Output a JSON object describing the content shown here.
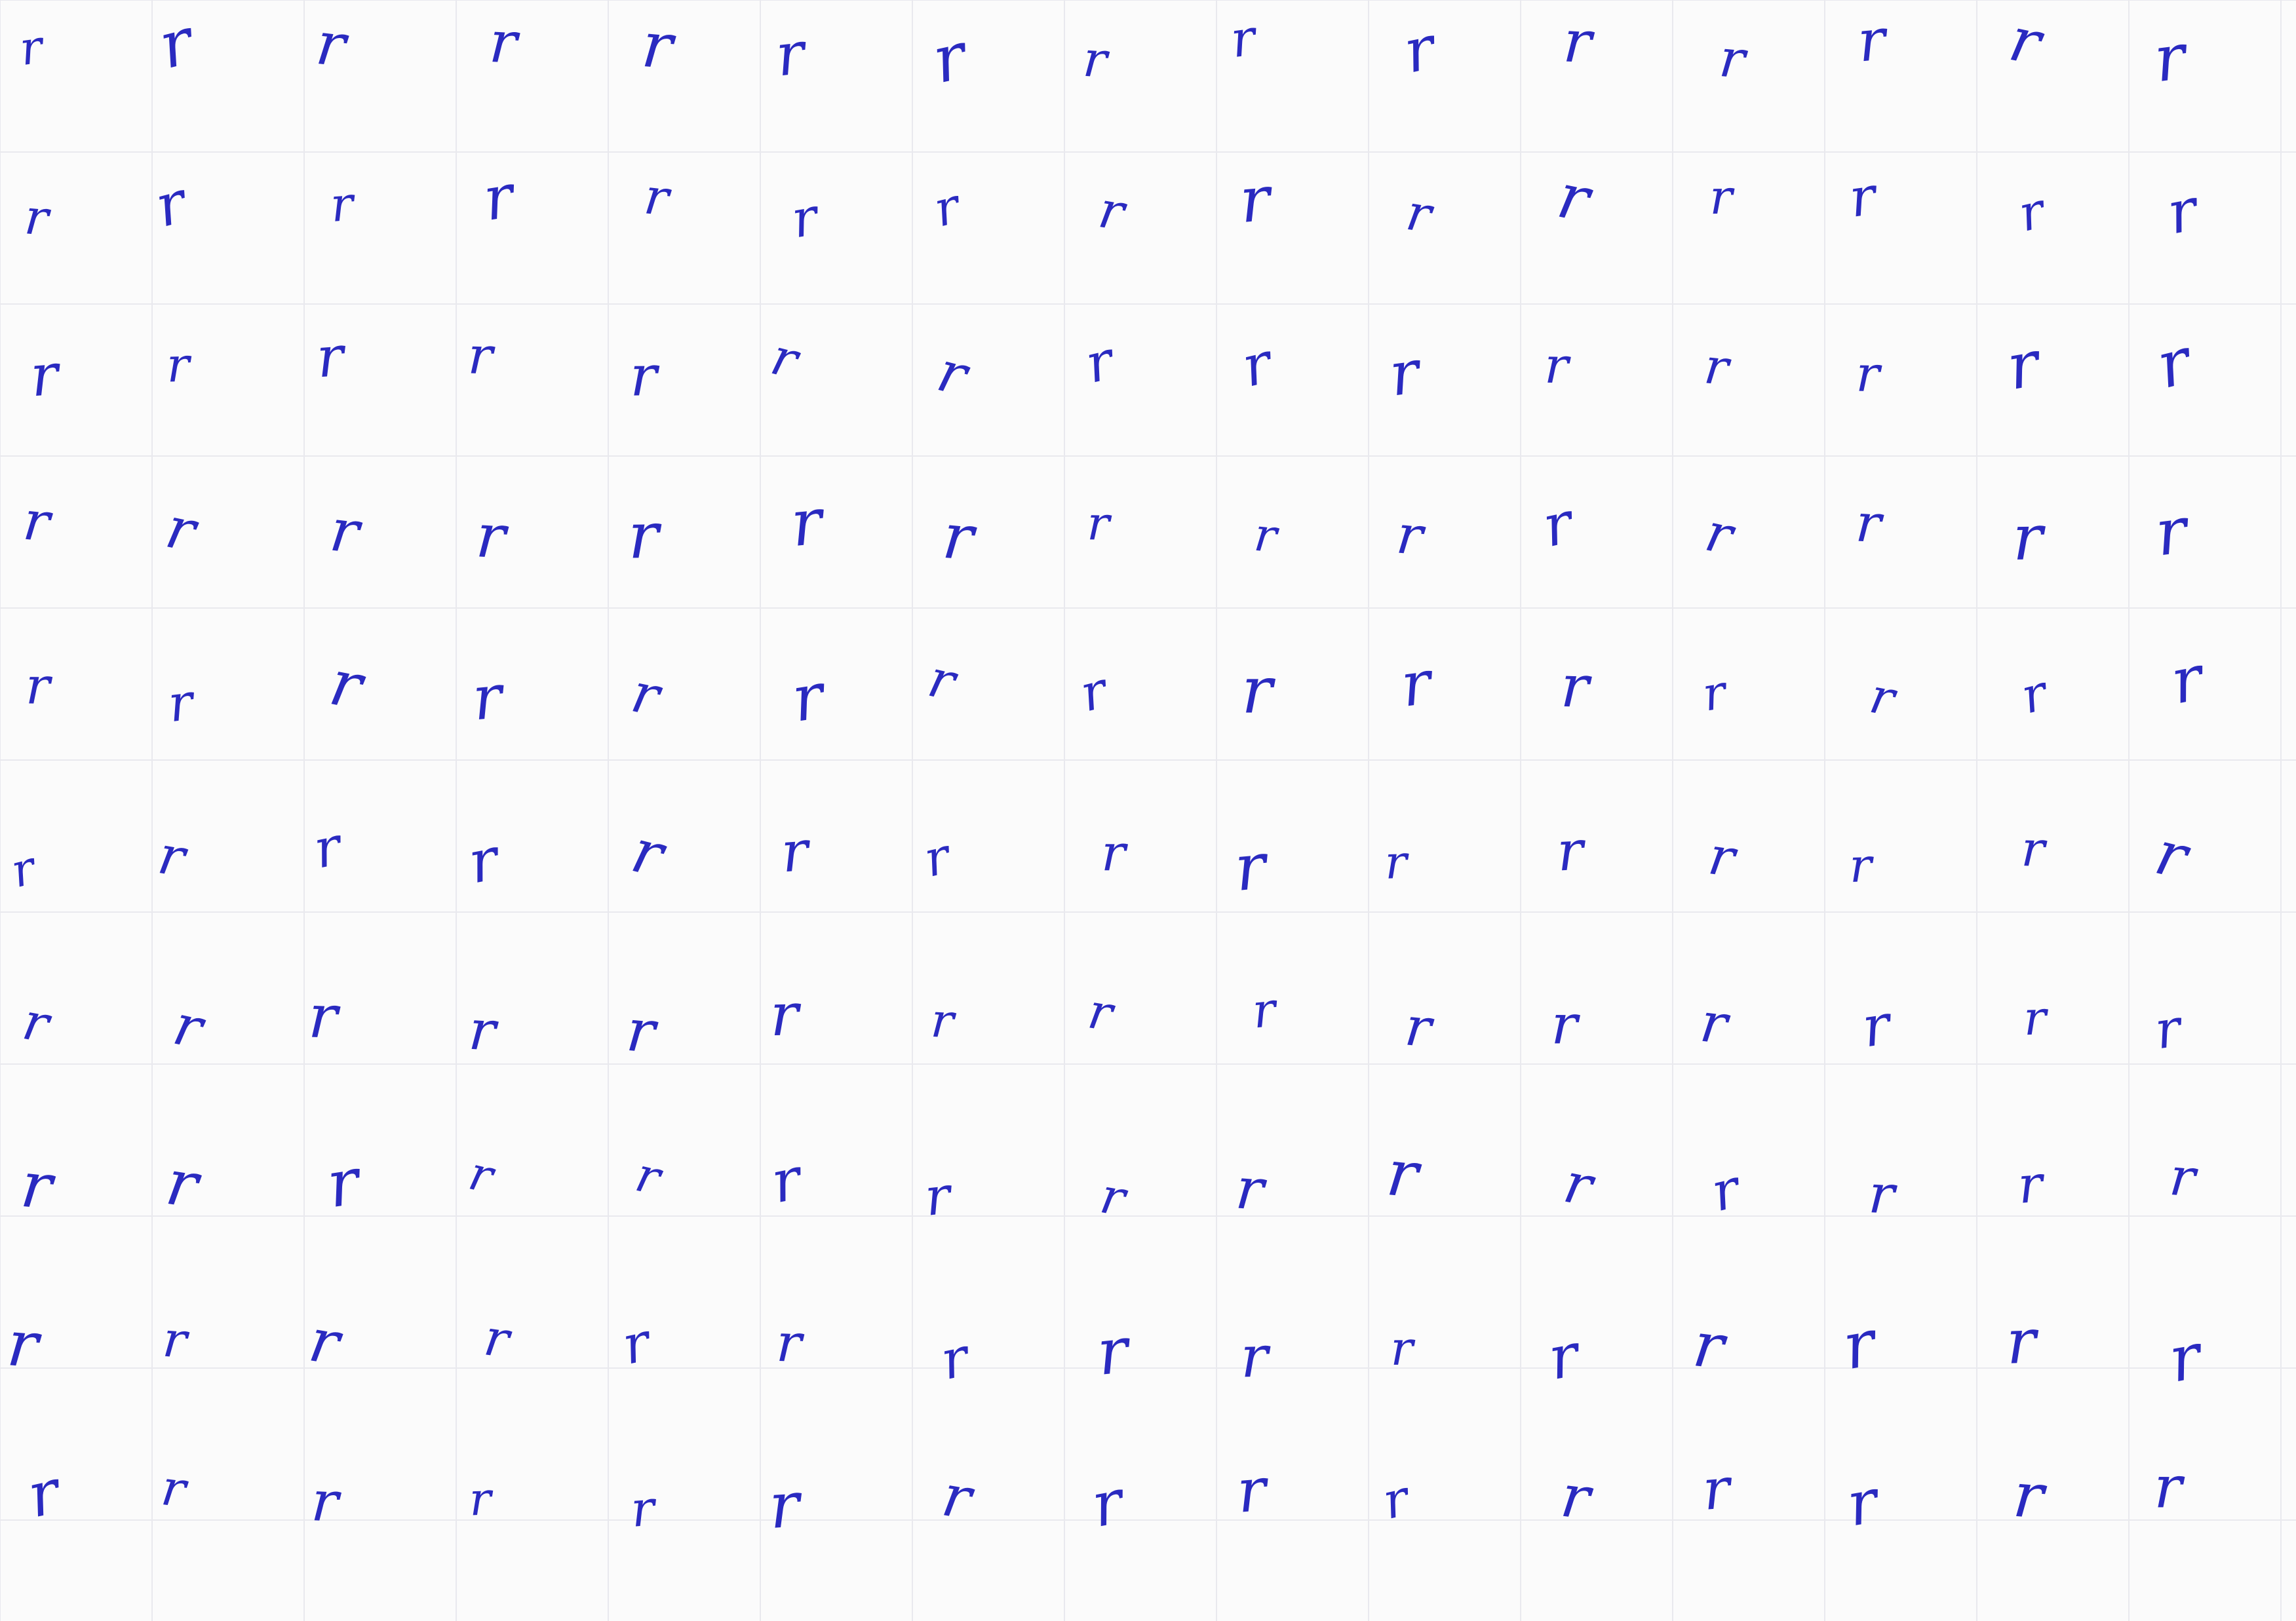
{
  "sheet": {
    "description_free": true,
    "ink_color": "#2a2ac0",
    "grid_color": "#e9e9ee",
    "paper_color": "#fbfbfb",
    "rows": 10,
    "columns": 15,
    "glyph_rows": [
      [
        "r",
        "r",
        "r",
        "r",
        "r",
        "r",
        "r",
        "r",
        "r",
        "r",
        "r",
        "r",
        "r",
        "r",
        "r"
      ],
      [
        "r",
        "r",
        "r",
        "r",
        "r",
        "r",
        "r",
        "r",
        "r",
        "r",
        "r",
        "r",
        "r",
        "r",
        "r"
      ],
      [
        "r",
        "r",
        "r",
        "r",
        "r",
        "r",
        "r",
        "r",
        "r",
        "r",
        "r",
        "r",
        "r",
        "r",
        "r"
      ],
      [
        "r",
        "r",
        "r",
        "r",
        "r",
        "r",
        "r",
        "r",
        "r",
        "r",
        "r",
        "r",
        "r",
        "r",
        "r"
      ],
      [
        "r",
        "r",
        "r",
        "r",
        "r",
        "r",
        "r",
        "r",
        "r",
        "r",
        "r",
        "r",
        "r",
        "r",
        "r"
      ],
      [
        "r",
        "r",
        "r",
        "r",
        "r",
        "r",
        "r",
        "r",
        "r",
        "r",
        "r",
        "r",
        "r",
        "r",
        "r"
      ],
      [
        "r",
        "r",
        "r",
        "r",
        "r",
        "r",
        "r",
        "r",
        "r",
        "r",
        "r",
        "r",
        "r",
        "r",
        "r"
      ],
      [
        "r",
        "r",
        "r",
        "r",
        "r",
        "r",
        "r",
        "r",
        "r",
        "r",
        "r",
        "r",
        "r",
        "r",
        "r"
      ],
      [
        "r",
        "r",
        "r",
        "r",
        "r",
        "r",
        "r",
        "r",
        "r",
        "r",
        "r",
        "r",
        "r",
        "r",
        "r"
      ],
      [
        "r",
        "r",
        "r",
        "r",
        "r",
        "r",
        "r",
        "r",
        "r",
        "r",
        "r",
        "r",
        "r",
        "r",
        "r"
      ]
    ]
  }
}
